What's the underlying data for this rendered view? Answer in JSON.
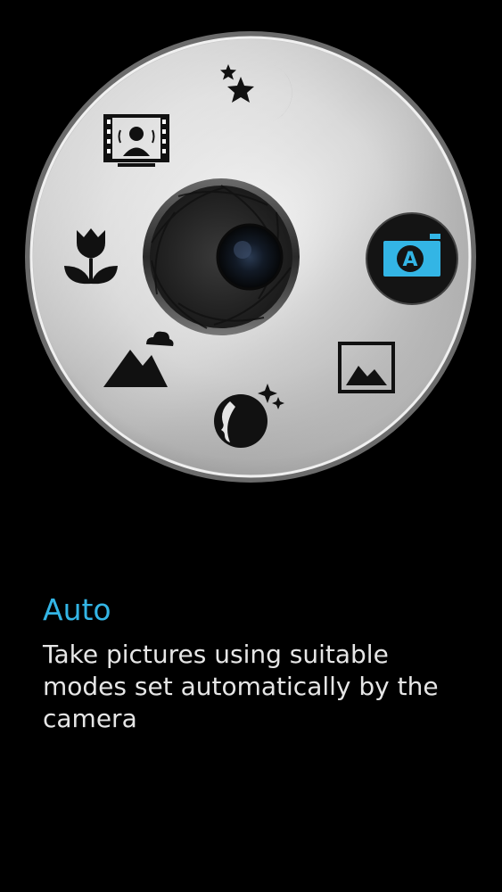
{
  "dial": {
    "selected_mode": "auto",
    "accent_color": "#33b5e5",
    "modes": [
      {
        "id": "night",
        "icon": "night-moon-stars-icon"
      },
      {
        "id": "video-portrait",
        "icon": "video-portrait-icon"
      },
      {
        "id": "macro",
        "icon": "flower-macro-icon"
      },
      {
        "id": "landscape",
        "icon": "mountain-landscape-icon"
      },
      {
        "id": "beauty",
        "icon": "beauty-face-icon"
      },
      {
        "id": "scenery",
        "icon": "picture-frame-icon"
      },
      {
        "id": "auto",
        "icon": "auto-camera-icon"
      }
    ]
  },
  "mode_info": {
    "title": "Auto",
    "description": "Take pictures using suitable modes set automatically by the camera"
  }
}
